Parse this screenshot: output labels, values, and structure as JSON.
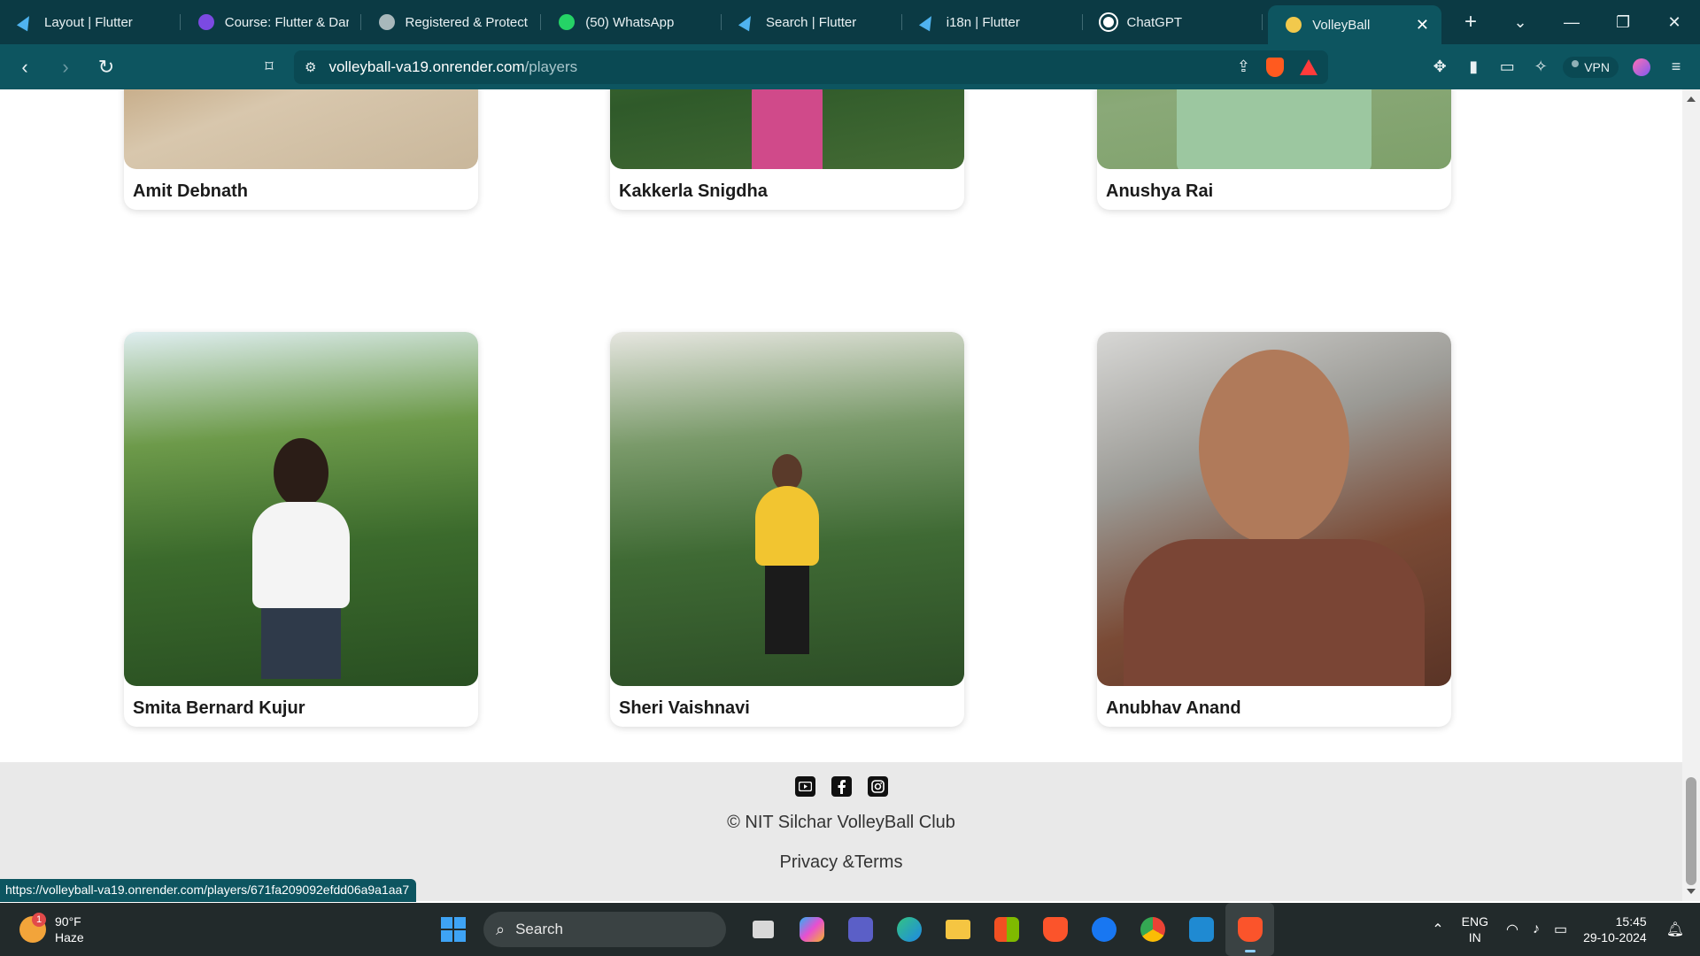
{
  "browser": {
    "tabs": [
      {
        "title": "Layout | Flutter",
        "favicon": "flutter-icon",
        "color": "#4fb3f0"
      },
      {
        "title": "Course: Flutter & Dar",
        "favicon": "course-icon",
        "color": "#7b4ae2"
      },
      {
        "title": "Registered & Protect",
        "favicon": "globe-icon",
        "color": "#a8b8bb"
      },
      {
        "title": "(50) WhatsApp",
        "favicon": "whatsapp-icon",
        "color": "#25d366"
      },
      {
        "title": "Search | Flutter",
        "favicon": "flutter-icon",
        "color": "#4fb3f0"
      },
      {
        "title": "i18n | Flutter",
        "favicon": "flutter-icon",
        "color": "#4fb3f0"
      },
      {
        "title": "ChatGPT",
        "favicon": "chatgpt-icon",
        "color": "#ffffff"
      },
      {
        "title": "VolleyBall",
        "favicon": "volleyball-icon",
        "color": "#f2c94c",
        "active": true
      }
    ],
    "url_host": "volleyball-va19.onrender.com",
    "url_path": "/players",
    "vpn_label": "VPN",
    "status_link": "https://volleyball-va19.onrender.com/players/671fa209092efdd06a9a1aa7"
  },
  "players": {
    "row1": [
      "Amit Debnath",
      "Kakkerla Snigdha",
      "Anushya Rai"
    ],
    "row2": [
      "Smita Bernard Kujur",
      "Sheri Vaishnavi",
      "Anubhav Anand"
    ]
  },
  "footer": {
    "social": [
      "youtube-icon",
      "facebook-icon",
      "instagram-icon"
    ],
    "copyright": "© NIT Silchar VolleyBall Club",
    "privacy": "Privacy &Terms"
  },
  "taskbar": {
    "weather_temp": "90°F",
    "weather_desc": "Haze",
    "weather_badge": "1",
    "search_label": "Search",
    "lang_top": "ENG",
    "lang_bottom": "IN",
    "time": "15:45",
    "date": "29-10-2024"
  }
}
